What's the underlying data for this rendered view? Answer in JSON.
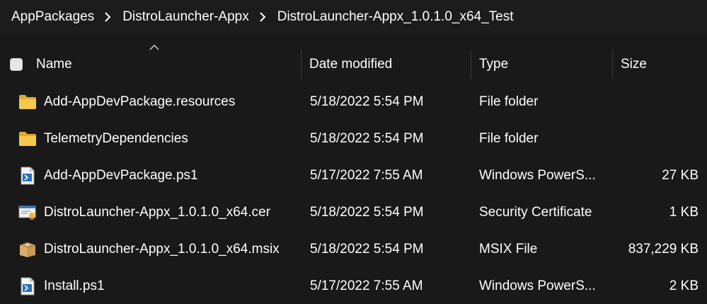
{
  "breadcrumb": {
    "items": [
      {
        "label": "AppPackages"
      },
      {
        "label": "DistroLauncher-Appx"
      },
      {
        "label": "DistroLauncher-Appx_1.0.1.0_x64_Test"
      }
    ],
    "separator_icon": "chevron-right-icon"
  },
  "columns": {
    "name": "Name",
    "date_modified": "Date modified",
    "type": "Type",
    "size": "Size",
    "sort_icon": "sort-ascending-icon"
  },
  "files": [
    {
      "name": "Add-AppDevPackage.resources",
      "date": "5/18/2022 5:54 PM",
      "type": "File folder",
      "size": "",
      "icon": "folder-icon"
    },
    {
      "name": "TelemetryDependencies",
      "date": "5/18/2022 5:54 PM",
      "type": "File folder",
      "size": "",
      "icon": "folder-icon"
    },
    {
      "name": "Add-AppDevPackage.ps1",
      "date": "5/17/2022 7:55 AM",
      "type": "Windows PowerS...",
      "size": "27 KB",
      "icon": "powershell-script-icon"
    },
    {
      "name": "DistroLauncher-Appx_1.0.1.0_x64.cer",
      "date": "5/18/2022 5:54 PM",
      "type": "Security Certificate",
      "size": "1 KB",
      "icon": "certificate-icon"
    },
    {
      "name": "DistroLauncher-Appx_1.0.1.0_x64.msix",
      "date": "5/18/2022 5:54 PM",
      "type": "MSIX File",
      "size": "837,229 KB",
      "icon": "package-icon"
    },
    {
      "name": "Install.ps1",
      "date": "5/17/2022 7:55 AM",
      "type": "Windows PowerS...",
      "size": "2 KB",
      "icon": "powershell-script-icon"
    }
  ],
  "colors": {
    "background": "#191919",
    "folder": "#f0c24b",
    "text": "#ffffff"
  }
}
